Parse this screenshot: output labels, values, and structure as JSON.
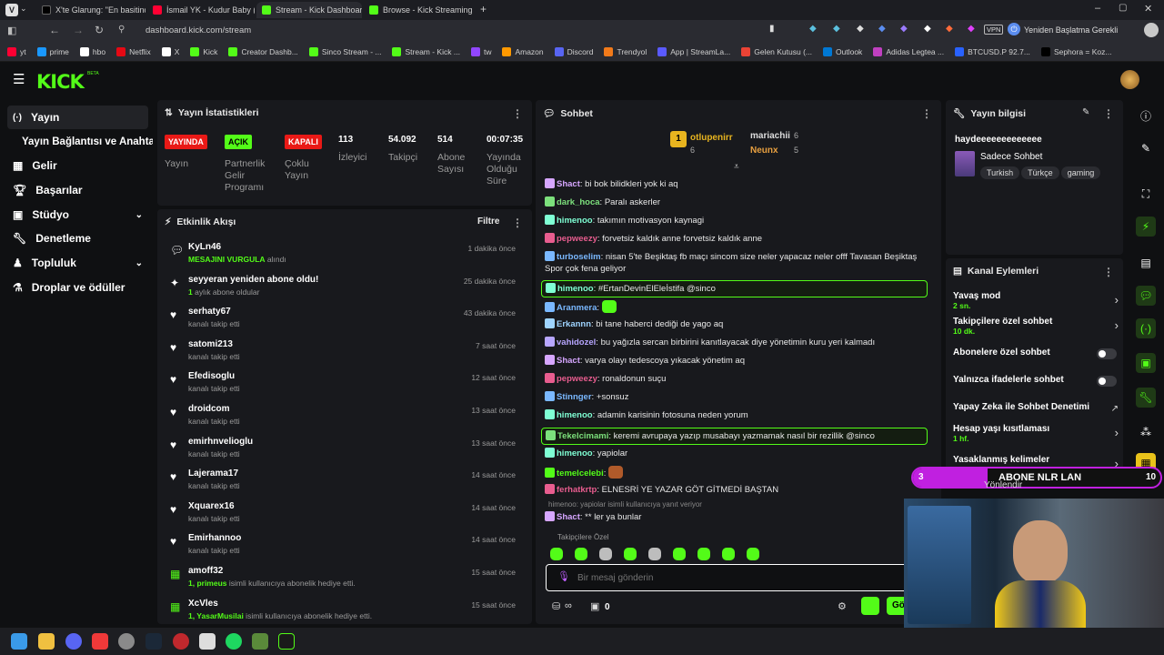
{
  "browser": {
    "tabs": [
      {
        "label": "X'te Glarung: \"En basitinde",
        "color": "#000000"
      },
      {
        "label": "İsmail YK - Kudur Baby ( Ud",
        "color": "#ff0033"
      },
      {
        "label": "Stream - Kick Dashboard",
        "color": "#53fc18"
      },
      {
        "label": "Browse - Kick Streaming",
        "color": "#53fc18"
      }
    ],
    "url": "dashboard.kick.com/stream",
    "restart_label": "Yeniden Başlatma Gerekli",
    "vpn_label": "VPN",
    "bookmarks": [
      "yt",
      "prime",
      "hbo",
      "Netflix",
      "X",
      "Kick",
      "Creator Dashb...",
      "Sinco Stream - ...",
      "Stream - Kick ...",
      "tw",
      "Amazon",
      "Discord",
      "Trendyol",
      "App | StreamLa...",
      "Gelen Kutusu (...",
      "Outlook",
      "Adidas Legtea ...",
      "BTCUSD.P 92.7...",
      "Sephora = Koz..."
    ]
  },
  "brand": {
    "logo": "KICK",
    "beta": "BETA",
    "accent": "#53fc18"
  },
  "sidebar": {
    "items": [
      {
        "label": "Yayın",
        "icon": "broadcast-icon"
      },
      {
        "label": "Yayın Bağlantısı ve Anahtarı",
        "icon": ""
      },
      {
        "label": "Gelir",
        "icon": "income-icon"
      },
      {
        "label": "Başarılar",
        "icon": "trophy-icon"
      },
      {
        "label": "Stüdyo",
        "icon": "studio-icon"
      },
      {
        "label": "Denetleme",
        "icon": "wrench-icon"
      },
      {
        "label": "Topluluk",
        "icon": "community-icon"
      },
      {
        "label": "Droplar ve ödüller",
        "icon": "drops-icon"
      }
    ]
  },
  "stats": {
    "title": "Yayın İstatistikleri",
    "columns": [
      {
        "badge": "YAYINDA",
        "label": "Yayın"
      },
      {
        "badge": "AÇIK",
        "label": "Partnerlik Gelir Programı"
      },
      {
        "badge": "KAPALI",
        "label": "Çoklu Yayın"
      },
      {
        "value": "113",
        "label": "İzleyici"
      },
      {
        "value": "54.092",
        "label": "Takipçi"
      },
      {
        "value": "514",
        "label": "Abone Sayısı"
      },
      {
        "value": "00:07:35",
        "label": "Yayında Olduğu Süre"
      }
    ]
  },
  "activity": {
    "title": "Etkinlik Akışı",
    "filter": "Filtre",
    "items": [
      {
        "name": "KyLn46",
        "sub_hl": "MESAJINI VURGULA",
        "sub": " alındı",
        "time": "1 dakika önce"
      },
      {
        "name": "seyyeran yeniden abone oldu!",
        "sub_hl": "1",
        "sub": " aylık abone oldular",
        "time": "25 dakika önce"
      },
      {
        "name": "serhaty67",
        "sub_hl": "",
        "sub": "kanalı takip etti",
        "time": "43 dakika önce"
      },
      {
        "name": "satomi213",
        "sub_hl": "",
        "sub": "kanalı takip etti",
        "time": "7 saat önce"
      },
      {
        "name": "Efedisoglu",
        "sub_hl": "",
        "sub": "kanalı takip etti",
        "time": "12 saat önce"
      },
      {
        "name": "droidcom",
        "sub_hl": "",
        "sub": "kanalı takip etti",
        "time": "13 saat önce"
      },
      {
        "name": "emirhnvelioglu",
        "sub_hl": "",
        "sub": "kanalı takip etti",
        "time": "13 saat önce"
      },
      {
        "name": "Lajerama17",
        "sub_hl": "",
        "sub": "kanalı takip etti",
        "time": "14 saat önce"
      },
      {
        "name": "Xquarex16",
        "sub_hl": "",
        "sub": "kanalı takip etti",
        "time": "14 saat önce"
      },
      {
        "name": "Emirhannoo",
        "sub_hl": "",
        "sub": "kanalı takip etti",
        "time": "14 saat önce"
      },
      {
        "name": "amoff32",
        "sub_hl": "1, primeus",
        "sub": " isimli kullanıcıya abonelik hediye etti.",
        "time": "15 saat önce"
      },
      {
        "name": "XcVles",
        "sub_hl": "1, YasarMusilai",
        "sub": " isimli kullanıcıya abonelik hediye etti.",
        "time": "15 saat önce"
      }
    ]
  },
  "chat": {
    "title": "Sohbet",
    "top_gifters": [
      {
        "rank": "1",
        "name": "otlupenirr",
        "count": "6"
      },
      {
        "name": "mariachii",
        "count": "6"
      },
      {
        "name": "Neunx",
        "count": "5"
      }
    ],
    "messages": [
      {
        "user": "Shact",
        "color": "#d6a6ff",
        "text": "bi bok bilidkleri yok ki aq"
      },
      {
        "user": "dark_hoca",
        "color": "#7ce07c",
        "text": "Paralı askerler"
      },
      {
        "user": "himenoo",
        "color": "#7fffd4",
        "text": "takımın motivasyon kaynagi"
      },
      {
        "user": "pepweezy",
        "color": "#e85d8f",
        "text": "forvetsiz kaldık anne forvetsiz kaldık anne"
      },
      {
        "user": "turboselim",
        "color": "#7ab8ff",
        "text": "nisan 5'te Beşiktaş fb maçı sincom size neler yapacaz neler offf Tavasan Beşiktaş Spor çok fena geliyor"
      },
      {
        "user": "himenoo",
        "color": "#7fffd4",
        "text": "#ErtanDevinElEleİstifa @sinco"
      },
      {
        "user": "Aranmera",
        "color": "#7ab8ff",
        "text": ""
      },
      {
        "user": "Erkannn",
        "color": "#9fd4ff",
        "text": "bi tane haberci dediği de yago aq"
      },
      {
        "user": "vahidozel",
        "color": "#b7a6ff",
        "text": "bu yağızla sercan birbirini kanıtlayacak diye yönetimin kuru yeri kalmadı"
      },
      {
        "user": "Shact",
        "color": "#d6a6ff",
        "text": "varya olayı tedescoya yıkacak yönetim aq"
      },
      {
        "user": "pepweezy",
        "color": "#e85d8f",
        "text": "ronaldonun suçu"
      },
      {
        "user": "Stinnger",
        "color": "#7ab8ff",
        "text": "+sonsuz"
      },
      {
        "user": "himenoo",
        "color": "#7fffd4",
        "text": "adamin karisinin fotosuna neden yorum"
      },
      {
        "user": "Tekelcimami",
        "color": "#7ce07c",
        "text": "keremi avrupaya yazıp musabayı yazmamak nasıl bir rezillik @sinco"
      },
      {
        "user": "himenoo",
        "color": "#7fffd4",
        "text": "yapiolar"
      },
      {
        "user": "temelcelebi",
        "color": "#53fc18",
        "text": ""
      },
      {
        "user": "ferhatkrtp",
        "color": "#e85d8f",
        "text": "ELNESRİ YE YAZAR GÖT GİTMEDİ BAŞTAN"
      },
      {
        "user": "Shact",
        "color": "#d6a6ff",
        "text": "** ler ya bunlar"
      }
    ],
    "reply_note": "himenoo: yapiolar isimli kullanıcıya yanıt veriyor",
    "followers_only": "Takipçilere Özel",
    "placeholder": "Bir mesaj gönderin",
    "points": "0",
    "send_label": "Gö"
  },
  "stream_info": {
    "title": "Yayın bilgisi",
    "stream_title": "haydeeeeeeeeeeeee",
    "category": "Sadece Sohbet",
    "tags": [
      "Turkish",
      "Türkçe",
      "gaming"
    ]
  },
  "channel_actions": {
    "title": "Kanal Eylemleri",
    "items": [
      {
        "label": "Yavaş mod",
        "sub": "2 sn.",
        "type": "chevron"
      },
      {
        "label": "Takipçilere özel sohbet",
        "sub": "10 dk.",
        "type": "chevron"
      },
      {
        "label": "Abonelere özel sohbet",
        "sub": "",
        "type": "toggle"
      },
      {
        "label": "Yalnızca ifadelerle sohbet",
        "sub": "",
        "type": "toggle"
      },
      {
        "label": "Yapay Zeka ile Sohbet Denetimi",
        "sub": "",
        "type": "external"
      },
      {
        "label": "Hesap yaşı kısıtlaması",
        "sub": "1 hf.",
        "type": "chevron"
      },
      {
        "label": "Yasaklanmış kelimeler",
        "sub": "",
        "type": "chevron"
      }
    ]
  },
  "overlay": {
    "goal_start": "3",
    "goal_text": "ABONE NLR LAN",
    "goal_end": "10",
    "goal_fraction": 0.3,
    "sub_text": "Yönlendir"
  }
}
